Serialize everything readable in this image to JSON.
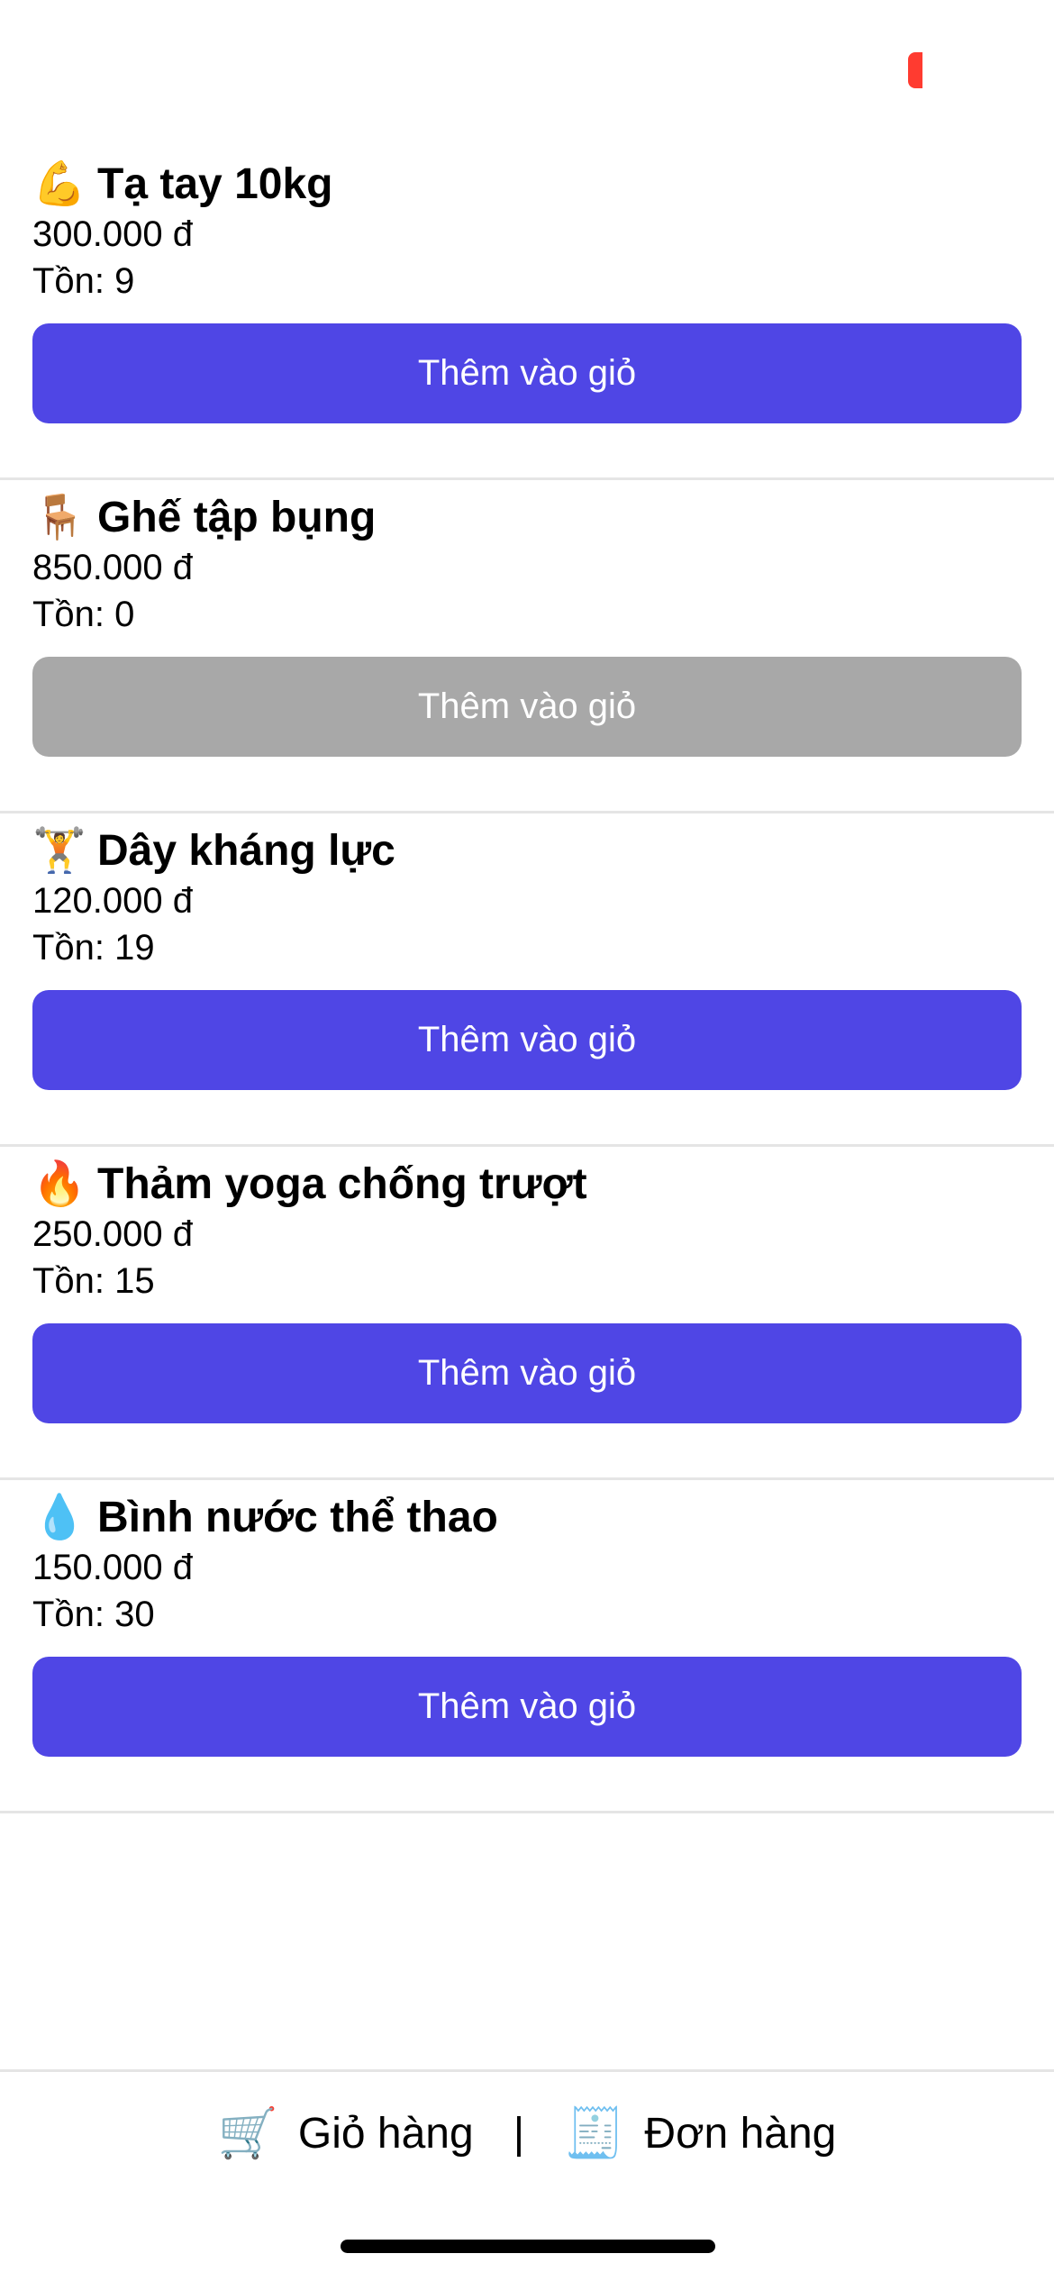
{
  "products": [
    {
      "emoji": "💪",
      "name": "Tạ tay 10kg",
      "price": "300.000 đ",
      "stock": "Tồn: 9",
      "button_label": "Thêm vào giỏ",
      "in_stock": true
    },
    {
      "emoji": "🪑",
      "name": "Ghế tập bụng",
      "price": "850.000 đ",
      "stock": "Tồn: 0",
      "button_label": "Thêm vào giỏ",
      "in_stock": false
    },
    {
      "emoji": "🏋️",
      "name": "Dây kháng lực",
      "price": "120.000 đ",
      "stock": "Tồn: 19",
      "button_label": "Thêm vào giỏ",
      "in_stock": true
    },
    {
      "emoji": "🔥",
      "name": "Thảm yoga chống trượt",
      "price": "250.000 đ",
      "stock": "Tồn: 15",
      "button_label": "Thêm vào giỏ",
      "in_stock": true
    },
    {
      "emoji": "💧",
      "name": "Bình nước thể thao",
      "price": "150.000 đ",
      "stock": "Tồn: 30",
      "button_label": "Thêm vào giỏ",
      "in_stock": true
    }
  ],
  "bottom_nav": {
    "cart_icon": "🛒",
    "cart_label": "Giỏ hàng",
    "separator": "|",
    "orders_icon": "🧾",
    "orders_label": "Đơn hàng"
  },
  "colors": {
    "accent": "#4f46e5",
    "disabled": "#a8a8a8",
    "status_indicator": "#ff3b30"
  }
}
